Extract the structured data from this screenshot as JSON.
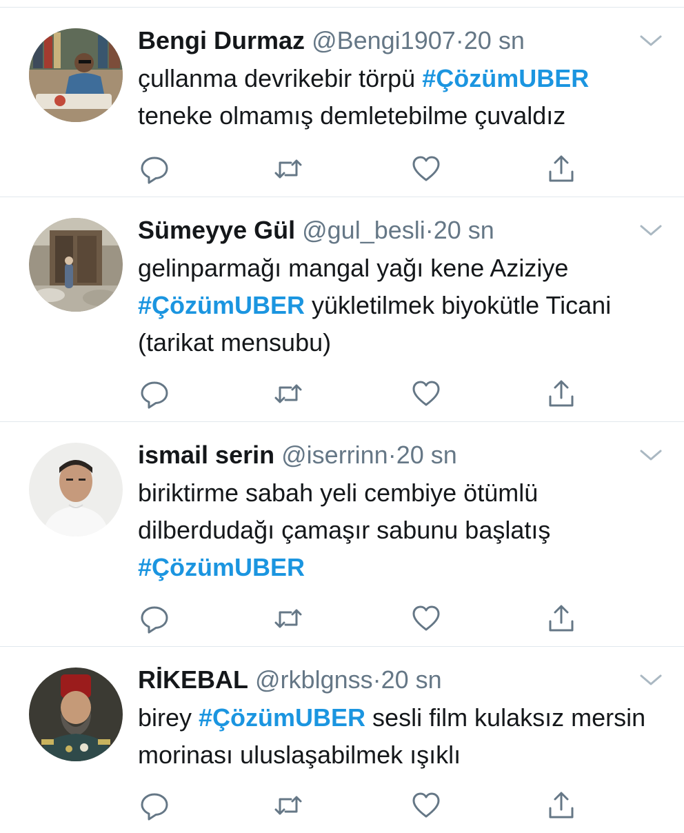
{
  "tweets": [
    {
      "name": "Bengi Durmaz",
      "handle": "@Bengi1907",
      "separator": "·",
      "time": "20 sn",
      "parts": [
        {
          "text": "çullanma devrikebir törpü ",
          "tag": false
        },
        {
          "text": "#ÇözümUBER",
          "tag": true
        },
        {
          "text": " teneke olmamış demletebilme çuvaldız",
          "tag": false
        }
      ]
    },
    {
      "name": "Sümeyye Gül",
      "handle": "@gul_besli",
      "separator": "·",
      "time": "20 sn",
      "parts": [
        {
          "text": "gelinparmağı mangal yağı kene Aziziye ",
          "tag": false
        },
        {
          "text": "#ÇözümUBER",
          "tag": true
        },
        {
          "text": " yükletilmek biyokütle Ticani (tarikat mensubu)",
          "tag": false
        }
      ]
    },
    {
      "name": "ismail serin",
      "handle": "@iserrinn",
      "separator": "·",
      "time": "20 sn",
      "parts": [
        {
          "text": "biriktirme sabah yeli cembiye ötümlü dilberdudağı çamaşır sabunu başlatış ",
          "tag": false
        },
        {
          "text": "#ÇözümUBER",
          "tag": true
        }
      ]
    },
    {
      "name": "RİKEBAL",
      "handle": "@rkblgnss",
      "separator": "·",
      "time": "20 sn",
      "parts": [
        {
          "text": "birey ",
          "tag": false
        },
        {
          "text": "#ÇözümUBER",
          "tag": true
        },
        {
          "text": " sesli film kulaksız mersin morinası uluslaşabilmek ışıklı",
          "tag": false
        }
      ]
    }
  ],
  "icons": {
    "reply": "reply-icon",
    "retweet": "retweet-icon",
    "like": "like-icon",
    "share": "share-icon",
    "caret": "chevron-down-icon"
  },
  "colors": {
    "hashtag": "#1b95e0",
    "secondary_text": "#657786",
    "primary_text": "#14171a",
    "divider": "#e1e8ed"
  }
}
